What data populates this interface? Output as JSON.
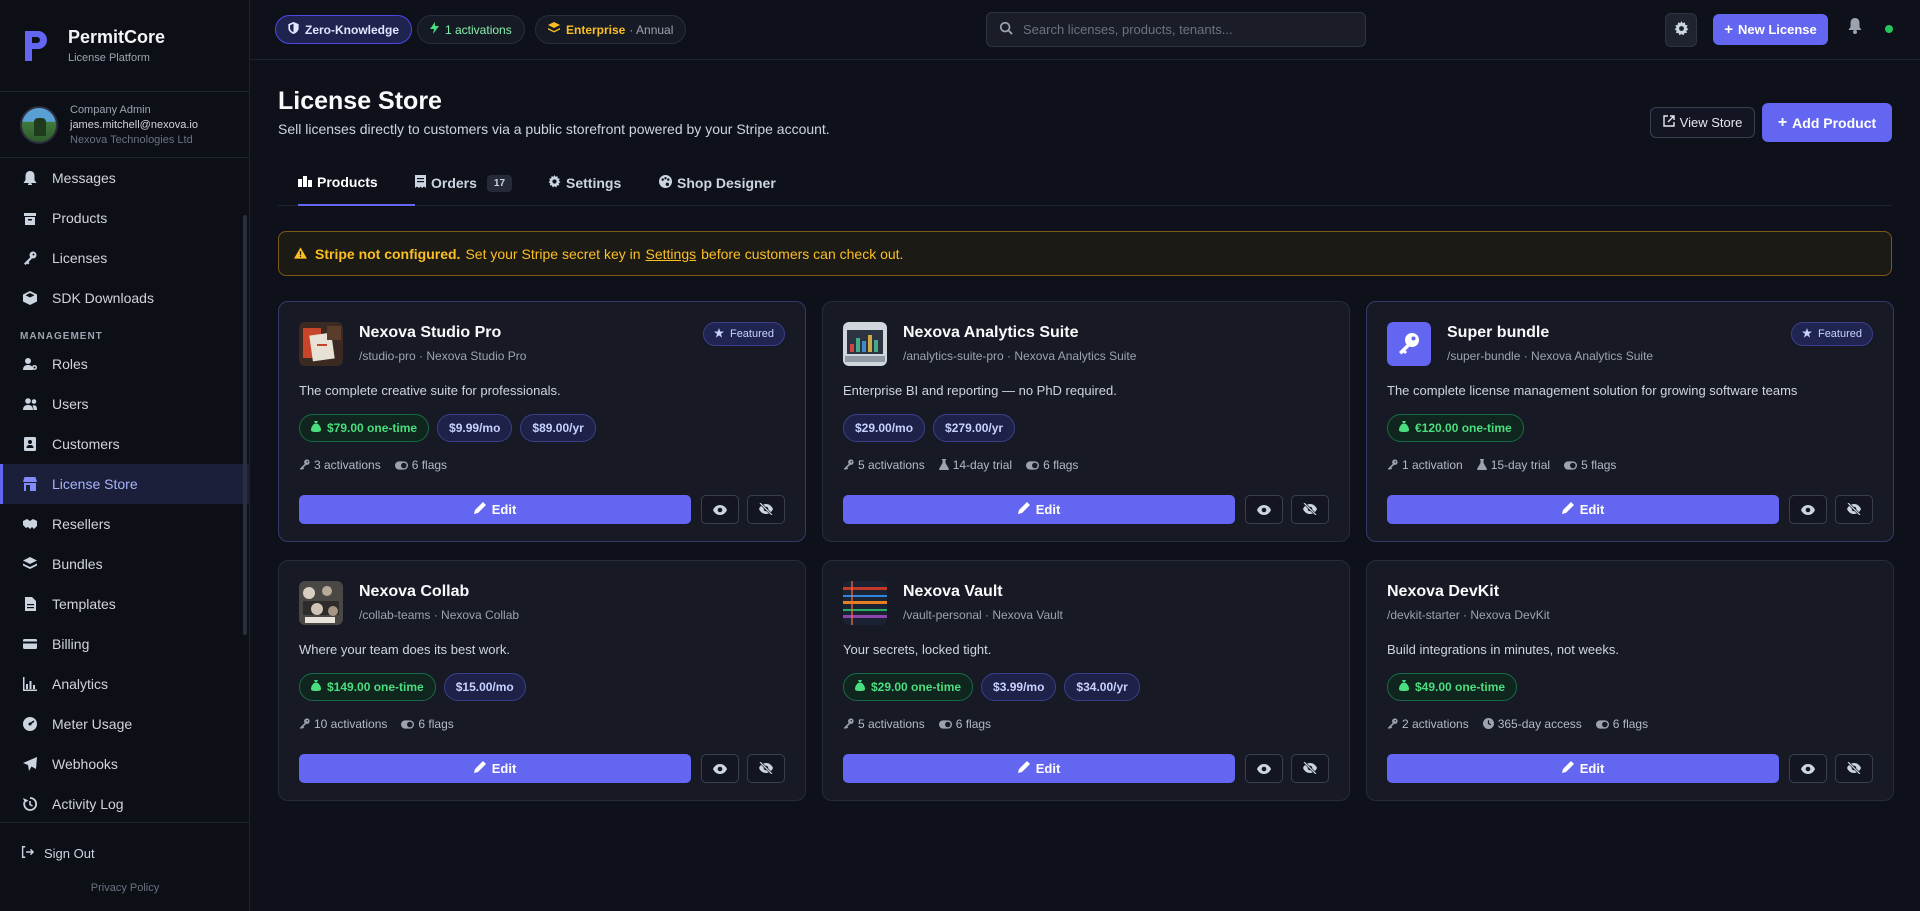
{
  "brand": {
    "name": "PermitCore",
    "subtitle": "License Platform"
  },
  "user": {
    "role": "Company Admin",
    "email": "james.mitchell@nexova.io",
    "org": "Nexova Technologies Ltd"
  },
  "nav": {
    "items_top": [
      {
        "label": "Messages",
        "icon": "bell-icon"
      },
      {
        "label": "Products",
        "icon": "box-icon"
      },
      {
        "label": "Licenses",
        "icon": "key-icon"
      },
      {
        "label": "SDK Downloads",
        "icon": "cube-icon"
      }
    ],
    "section_label": "MANAGEMENT",
    "items_mgmt": [
      {
        "label": "Roles",
        "icon": "user-gear-icon"
      },
      {
        "label": "Users",
        "icon": "users-icon"
      },
      {
        "label": "Customers",
        "icon": "address-book-icon"
      },
      {
        "label": "License Store",
        "icon": "store-icon",
        "active": true
      },
      {
        "label": "Resellers",
        "icon": "handshake-icon"
      },
      {
        "label": "Bundles",
        "icon": "layers-icon"
      },
      {
        "label": "Templates",
        "icon": "file-icon"
      },
      {
        "label": "Billing",
        "icon": "credit-card-icon"
      },
      {
        "label": "Analytics",
        "icon": "chart-icon"
      },
      {
        "label": "Meter Usage",
        "icon": "gauge-icon"
      },
      {
        "label": "Webhooks",
        "icon": "paper-plane-icon"
      },
      {
        "label": "Activity Log",
        "icon": "history-icon"
      }
    ],
    "signout": "Sign Out",
    "privacy": "Privacy Policy"
  },
  "topbar": {
    "zk_label": "Zero-Knowledge",
    "activations_label": "1 activations",
    "plan_label": "Enterprise",
    "plan_period": "· Annual",
    "search_placeholder": "Search licenses, products, tenants...",
    "new_license_label": "New License"
  },
  "page": {
    "title": "License Store",
    "subtitle": "Sell licenses directly to customers via a public storefront powered by your Stripe account.",
    "view_store_label": "View Store",
    "add_product_label": "Add Product"
  },
  "tabs": [
    {
      "label": "Products",
      "icon": "products-icon",
      "active": true
    },
    {
      "label": "Orders",
      "icon": "receipt-icon",
      "count": "17"
    },
    {
      "label": "Settings",
      "icon": "gear-icon"
    },
    {
      "label": "Shop Designer",
      "icon": "palette-icon"
    }
  ],
  "alert": {
    "strong": "Stripe not configured.",
    "before_link": "Set your Stripe secret key in",
    "link": "Settings",
    "after_link": "before customers can check out."
  },
  "products": [
    {
      "title": "Nexova Studio Pro",
      "sub": "/studio-pro · Nexova Studio Pro",
      "featured": true,
      "featured_label": "Featured",
      "desc": "The complete creative suite for professionals.",
      "onetime": "$79.00 one-time",
      "subs": [
        "$9.99/mo",
        "$89.00/yr"
      ],
      "meta": [
        {
          "icon": "key-icon",
          "text": "3 activations"
        },
        {
          "icon": "toggle-icon",
          "text": "6 flags"
        }
      ],
      "thumb": "studio"
    },
    {
      "title": "Nexova Analytics Suite",
      "sub": "/analytics-suite-pro · Nexova Analytics Suite",
      "featured": false,
      "desc": "Enterprise BI and reporting — no PhD required.",
      "onetime": "",
      "subs": [
        "$29.00/mo",
        "$279.00/yr"
      ],
      "meta": [
        {
          "icon": "key-icon",
          "text": "5 activations"
        },
        {
          "icon": "flask-icon",
          "text": "14-day trial"
        },
        {
          "icon": "toggle-icon",
          "text": "6 flags"
        }
      ],
      "thumb": "analytics"
    },
    {
      "title": "Super bundle",
      "sub": "/super-bundle · Nexova Analytics Suite",
      "featured": true,
      "featured_label": "Featured",
      "desc": "The complete license management solution for growing software teams",
      "onetime": "€120.00 one-time",
      "subs": [],
      "meta": [
        {
          "icon": "key-icon",
          "text": "1 activation"
        },
        {
          "icon": "flask-icon",
          "text": "15-day trial"
        },
        {
          "icon": "toggle-icon",
          "text": "5 flags"
        }
      ],
      "thumb": "key"
    },
    {
      "title": "Nexova Collab",
      "sub": "/collab-teams · Nexova Collab",
      "featured": false,
      "desc": "Where your team does its best work.",
      "onetime": "$149.00 one-time",
      "subs": [
        "$15.00/mo"
      ],
      "meta": [
        {
          "icon": "key-icon",
          "text": "10 activations"
        },
        {
          "icon": "toggle-icon",
          "text": "6 flags"
        }
      ],
      "thumb": "collab"
    },
    {
      "title": "Nexova Vault",
      "sub": "/vault-personal · Nexova Vault",
      "featured": false,
      "desc": "Your secrets, locked tight.",
      "onetime": "$29.00 one-time",
      "subs": [
        "$3.99/mo",
        "$34.00/yr"
      ],
      "meta": [
        {
          "icon": "key-icon",
          "text": "5 activations"
        },
        {
          "icon": "toggle-icon",
          "text": "6 flags"
        }
      ],
      "thumb": "vault"
    },
    {
      "title": "Nexova DevKit",
      "sub": "/devkit-starter · Nexova DevKit",
      "featured": false,
      "desc": "Build integrations in minutes, not weeks.",
      "onetime": "$49.00 one-time",
      "subs": [],
      "meta": [
        {
          "icon": "key-icon",
          "text": "2 activations"
        },
        {
          "icon": "clock-icon",
          "text": "365-day access"
        },
        {
          "icon": "toggle-icon",
          "text": "6 flags"
        }
      ],
      "thumb": ""
    }
  ],
  "edit_label": "Edit",
  "colors": {
    "accent": "#6366f1",
    "success": "#4ade80",
    "warning": "#fbbf24",
    "background": "#0f111a"
  }
}
